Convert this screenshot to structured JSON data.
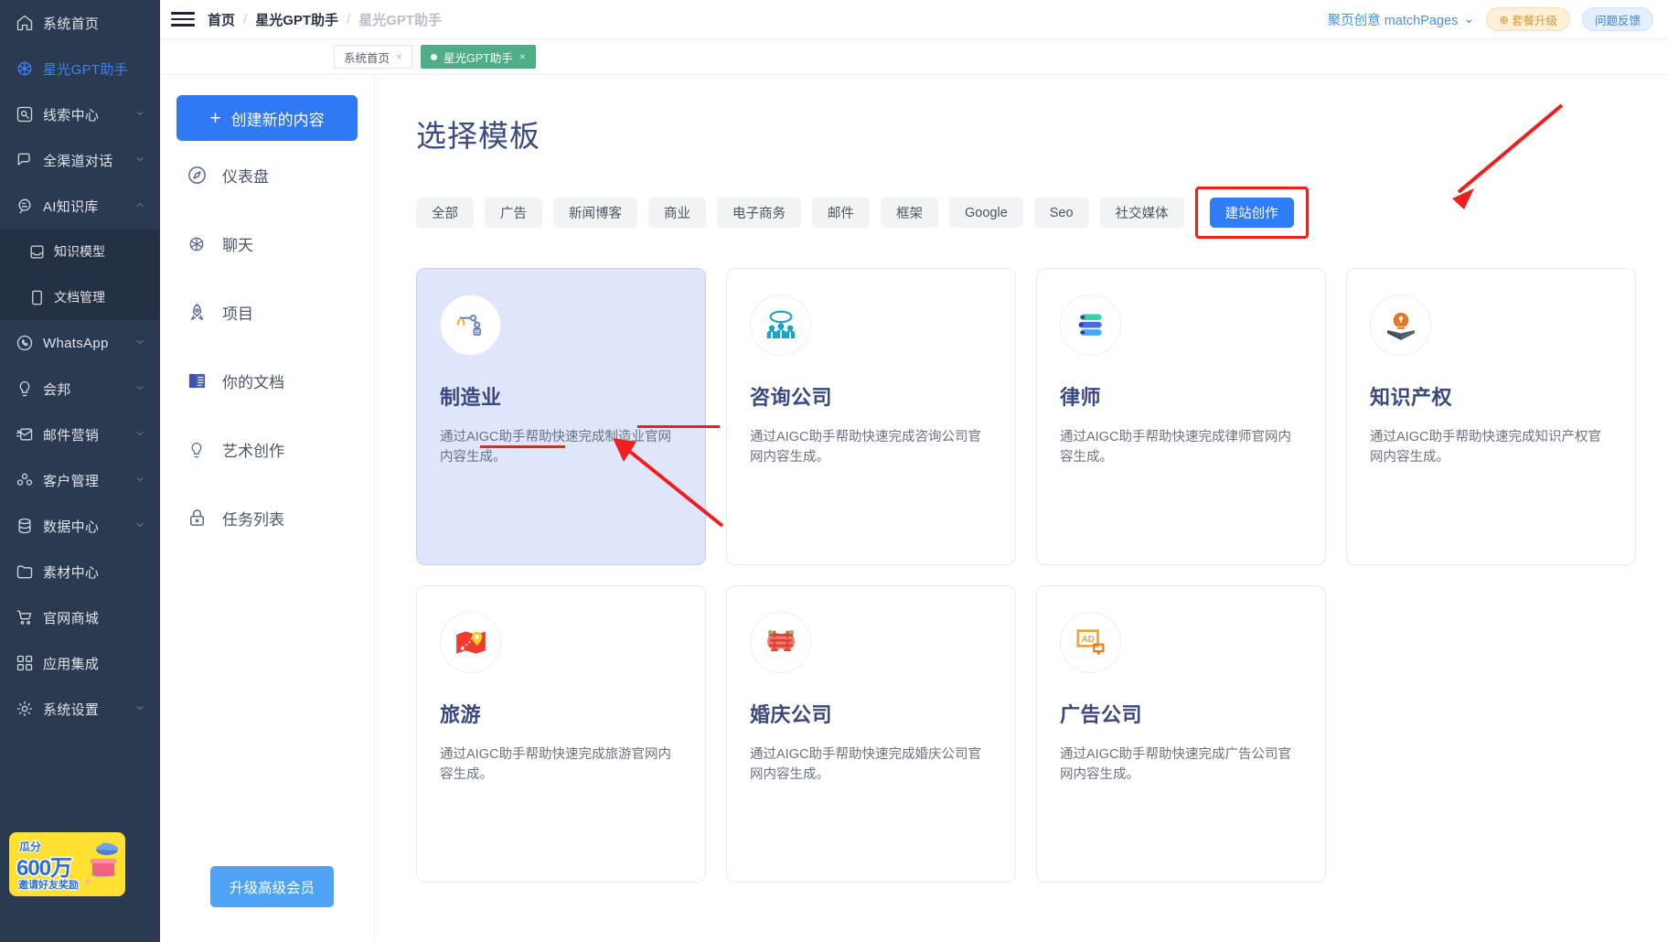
{
  "sidebar": {
    "items": [
      {
        "label": "系统首页",
        "icon": "home-icon",
        "expandable": false,
        "active": false
      },
      {
        "label": "星光GPT助手",
        "icon": "gpt-icon",
        "expandable": false,
        "active": true
      },
      {
        "label": "线索中心",
        "icon": "clue-icon",
        "expandable": true,
        "active": false
      },
      {
        "label": "全渠道对话",
        "icon": "chat-icon",
        "expandable": true,
        "active": false
      },
      {
        "label": "AI知识库",
        "icon": "ai-brain-icon",
        "expandable": true,
        "active": false,
        "expanded": true
      }
    ],
    "sub_items": [
      {
        "label": "知识模型",
        "icon": "model-icon"
      },
      {
        "label": "文档管理",
        "icon": "doc-icon"
      }
    ],
    "items_after": [
      {
        "label": "WhatsApp",
        "icon": "whatsapp-icon",
        "expandable": true
      },
      {
        "label": "会邦",
        "icon": "bulb-icon",
        "expandable": true
      },
      {
        "label": "邮件营销",
        "icon": "mail-send-icon",
        "expandable": true
      },
      {
        "label": "客户管理",
        "icon": "users-icon",
        "expandable": true
      },
      {
        "label": "数据中心",
        "icon": "database-icon",
        "expandable": true
      },
      {
        "label": "素材中心",
        "icon": "folder-icon",
        "expandable": false
      },
      {
        "label": "官网商城",
        "icon": "cart-icon",
        "expandable": false
      },
      {
        "label": "应用集成",
        "icon": "grid-icon",
        "expandable": false
      },
      {
        "label": "系统设置",
        "icon": "gear-icon",
        "expandable": true
      }
    ],
    "promo": {
      "line1": "瓜分",
      "line2": "600万",
      "line3": "邀请好友奖励",
      "bg": "#ffe033",
      "text_color": "#2b6fd6"
    }
  },
  "topbar": {
    "breadcrumb": [
      "首页",
      "星光GPT助手",
      "星光GPT助手"
    ],
    "separator": "/",
    "account": "聚页创意 matchPages",
    "account_caret": "⌄",
    "upgrade_label": "套餐升级",
    "upgrade_icon": "⊕",
    "feedback_label": "问题反馈"
  },
  "tabs": [
    {
      "label": "系统首页",
      "close": "×",
      "active": false
    },
    {
      "label": "星光GPT助手",
      "close": "×",
      "active": true
    }
  ],
  "left_panel": {
    "create_label": "创建新的内容",
    "create_plus": "+",
    "items": [
      {
        "label": "仪表盘",
        "icon": "compass-icon"
      },
      {
        "label": "聊天",
        "icon": "gpt-icon"
      },
      {
        "label": "项目",
        "icon": "rocket-icon"
      },
      {
        "label": "你的文档",
        "icon": "book-icon"
      },
      {
        "label": "艺术创作",
        "icon": "bulb-icon"
      },
      {
        "label": "任务列表",
        "icon": "lock-icon"
      }
    ],
    "upgrade_label": "升级高级会员"
  },
  "content": {
    "title": "选择模板",
    "filters": [
      {
        "label": "全部",
        "active": false
      },
      {
        "label": "广告",
        "active": false
      },
      {
        "label": "新闻博客",
        "active": false
      },
      {
        "label": "商业",
        "active": false
      },
      {
        "label": "电子商务",
        "active": false
      },
      {
        "label": "邮件",
        "active": false
      },
      {
        "label": "框架",
        "active": false
      },
      {
        "label": "Google",
        "active": false
      },
      {
        "label": "Seo",
        "active": false
      },
      {
        "label": "社交媒体",
        "active": false
      },
      {
        "label": "建站创作",
        "active": true,
        "highlighted": true
      }
    ],
    "cards": [
      {
        "title": "制造业",
        "desc": "通过AIGC助手帮助快速完成制造业官网内容生成。",
        "icon": "robot-arm-icon",
        "selected": true
      },
      {
        "title": "咨询公司",
        "desc": "通过AIGC助手帮助快速完成咨询公司官网内容生成。",
        "icon": "consulting-people-icon",
        "selected": false
      },
      {
        "title": "律师",
        "desc": "通过AIGC助手帮助快速完成律师官网内容生成。",
        "icon": "law-books-icon",
        "selected": false
      },
      {
        "title": "知识产权",
        "desc": "通过AIGC助手帮助快速完成知识产权官网内容生成。",
        "icon": "ip-bulb-book-icon",
        "selected": false
      },
      {
        "title": "旅游",
        "desc": "通过AIGC助手帮助快速完成旅游官网内容生成。",
        "icon": "travel-map-icon",
        "selected": false
      },
      {
        "title": "婚庆公司",
        "desc": "通过AIGC助手帮助快速完成婚庆公司官网内容生成。",
        "icon": "wedding-xi-icon",
        "selected": false
      },
      {
        "title": "广告公司",
        "desc": "通过AIGC助手帮助快速完成广告公司官网内容生成。",
        "icon": "ad-board-icon",
        "selected": false
      }
    ]
  },
  "annotations": {
    "color": "#ef1f1f",
    "arrow_to_button": "red-arrow-pointing-to-建站创作",
    "arrow_to_card": "red-arrow-pointing-to-制造业-card",
    "underline_1": "制造业官",
    "underline_2": "网内容生成。",
    "box_around": "建站创作"
  },
  "colors": {
    "sidebar_bg": "#2c3a51",
    "accent_blue": "#2f7cf6",
    "tab_green": "#4caf86",
    "annotation_red": "#ef1f1f",
    "card_selected_bg": "#dfe6fb"
  }
}
